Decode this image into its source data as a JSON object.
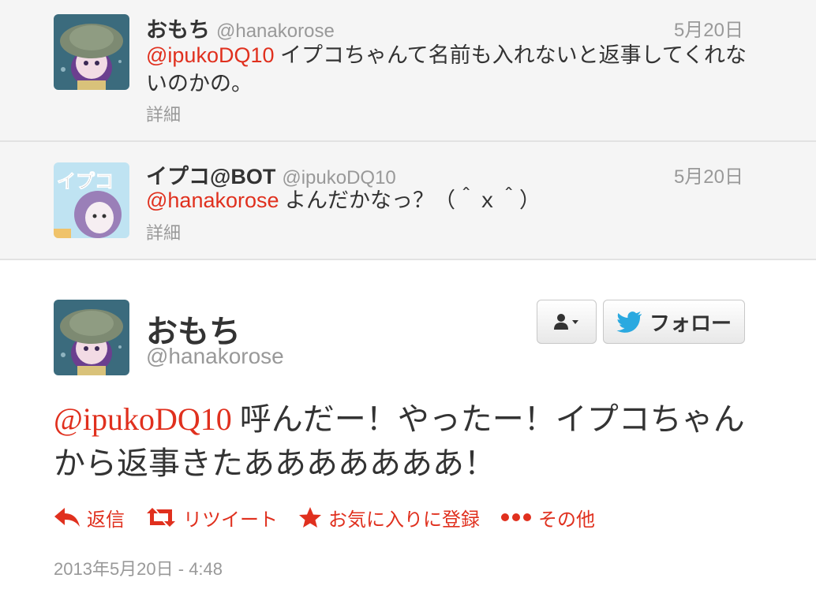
{
  "replies": [
    {
      "name": "おもち",
      "screen_name": "@hanakorose",
      "date": "5月20日",
      "mention": "@ipukoDQ10",
      "text": " イプコちゃんて名前も入れないと返事してくれないのかの。",
      "details_label": "詳細",
      "avatar": "mochi-avatar"
    },
    {
      "name": "イプコ@BOT",
      "screen_name": "@ipukoDQ10",
      "date": "5月20日",
      "mention": "@hanakorose",
      "text": " よんだかなっ？（＾ｘ＾）",
      "details_label": "詳細",
      "avatar": "ipuko-avatar",
      "avatar_text": "イプコ"
    }
  ],
  "main_tweet": {
    "name": "おもち",
    "screen_name": "@hanakorose",
    "mention": "@ipukoDQ10",
    "text": " 呼んだー！やったー！イプコちゃんから返事きたあああああああ！",
    "follow_label": "フォロー",
    "timestamp": "2013年5月20日 - 4:48",
    "actions": {
      "reply": "返信",
      "retweet": "リツイート",
      "favorite": "お気に入りに登録",
      "more": "その他"
    }
  },
  "colors": {
    "accent": "#e0301e",
    "twitter_blue": "#2aa9e0",
    "muted": "#999999"
  }
}
